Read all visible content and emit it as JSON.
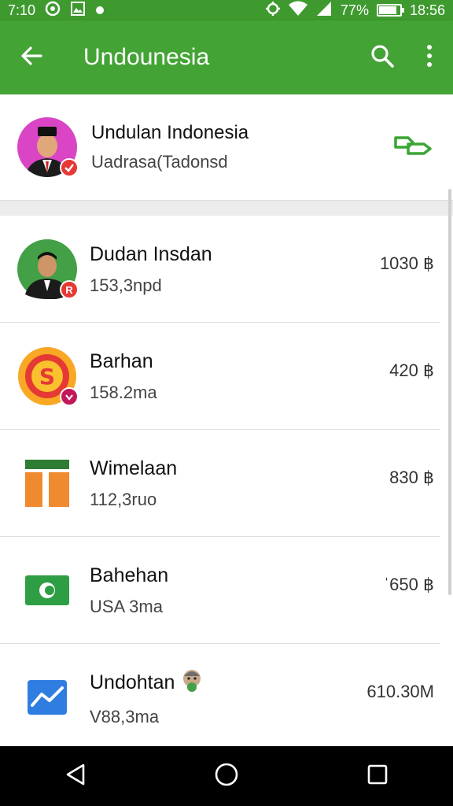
{
  "status_bar": {
    "time_left": "7:10",
    "battery_percent_text": "77%",
    "battery_level": 0.77,
    "clock": "18:56"
  },
  "app_bar": {
    "title": "Undounesia",
    "icons": [
      "back-arrow-icon",
      "search-icon",
      "more-vert-icon"
    ],
    "color": "#43a335"
  },
  "profile": {
    "name": "Undulan Indonesia",
    "subtitle": "Uadrasa(Tadonsd",
    "badge_color": "#e53935",
    "action_icon": "link-icon"
  },
  "list": {
    "items": [
      {
        "title": "Dudan Insdan",
        "subtitle": "153,3npd",
        "amount": "1030 ฿",
        "icon": "person-avatar-icon"
      },
      {
        "title": "Barhan",
        "subtitle": "158.2ma",
        "amount": "420 ฿",
        "icon": "coin-icon"
      },
      {
        "title": "Wimelaan",
        "subtitle": "112,3ruo",
        "amount": "830 ฿",
        "icon": "columns-icon"
      },
      {
        "title": "Bahehan",
        "subtitle": "USA 3ma",
        "amount": "ˈ650 ฿",
        "icon": "banknote-icon"
      },
      {
        "title": "Undohtan",
        "subtitle": "V88,3ma",
        "amount": "610.30M",
        "icon": "trend-chart-icon"
      }
    ]
  },
  "nav_bar": {
    "icons": [
      "back-triangle-icon",
      "home-circle-icon",
      "recents-square-icon"
    ]
  }
}
